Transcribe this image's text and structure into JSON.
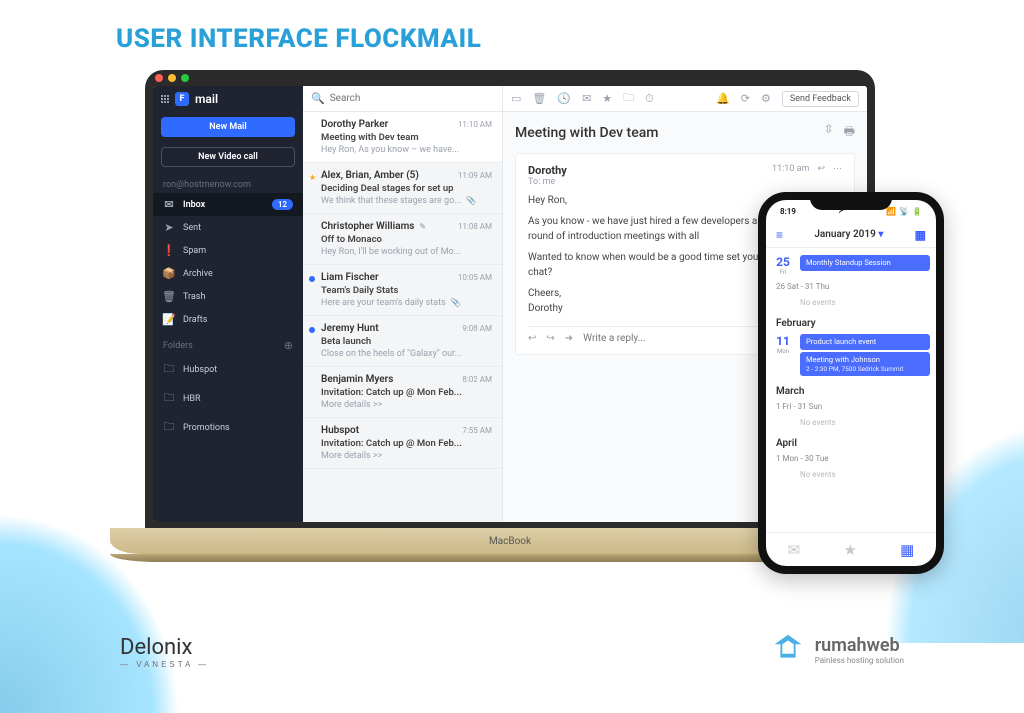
{
  "page_title": "USER INTERFACE FLOCKMAIL",
  "macbook_label": "MacBook",
  "app_brand": "mail",
  "sidebar": {
    "new_mail": "New Mail",
    "new_video": "New Video call",
    "account": "ron@hostmenow.com",
    "items": [
      {
        "icon": "✉",
        "label": "Inbox",
        "count": "12",
        "active": true
      },
      {
        "icon": "➤",
        "label": "Sent"
      },
      {
        "icon": "❗",
        "label": "Spam"
      },
      {
        "icon": "📦",
        "label": "Archive"
      },
      {
        "icon": "🗑",
        "label": "Trash"
      },
      {
        "icon": "📝",
        "label": "Drafts"
      }
    ],
    "folders_label": "Folders",
    "folders": [
      {
        "label": "Hubspot"
      },
      {
        "label": "HBR"
      },
      {
        "label": "Promotions"
      }
    ]
  },
  "search_placeholder": "Search",
  "toolbar": {
    "feedback": "Send Feedback"
  },
  "messages": [
    {
      "from": "Dorothy Parker",
      "time": "11:10 AM",
      "subj": "Meeting with Dev team",
      "prev": "Hey Ron, As you know – we have...",
      "sel": true
    },
    {
      "from": "Alex, Brian, Amber (5)",
      "time": "11:09 AM",
      "subj": "Deciding Deal stages for set up",
      "prev": "We think that these stages are go...",
      "star": true,
      "clip": true
    },
    {
      "from": "Christopher Williams",
      "time": "11:08 AM",
      "subj": "Off to Monaco",
      "prev": "Hey Ron, I'll be working out of Mo...",
      "pen": true
    },
    {
      "from": "Liam Fischer",
      "time": "10:05 AM",
      "subj": "Team's Daily Stats",
      "prev": "Here are your team's daily stats",
      "dot": true,
      "clip": true
    },
    {
      "from": "Jeremy Hunt",
      "time": "9:08 AM",
      "subj": "Beta launch",
      "prev": "Close on the heels of \"Galaxy\" our...",
      "dot": true
    },
    {
      "from": "Benjamin Myers",
      "time": "8:02 AM",
      "subj": "Invitation: Catch up @ Mon Feb...",
      "prev": "More details >>"
    },
    {
      "from": "Hubspot",
      "time": "7:55 AM",
      "subj": "Invitation: Catch up @ Mon Feb...",
      "prev": "More details >>"
    }
  ],
  "reader": {
    "subject": "Meeting with Dev team",
    "from": "Dorothy",
    "to": "To: me",
    "time": "11:10 am",
    "body": {
      "greeting": "Hey Ron,",
      "p1": "As you know - we have just hired a few developers and were doing a round of introduction meetings with all",
      "p2": "Wanted to know when would be a good time set you up for a quick chat?",
      "sign1": "Cheers,",
      "sign2": "Dorothy"
    },
    "reply_placeholder": "Write a reply..."
  },
  "phone": {
    "status_time": "8:19",
    "month": "January 2019",
    "sections": [
      {
        "day": "25",
        "wd": "Fri",
        "events": [
          {
            "title": "Monthly Standup Session"
          }
        ]
      },
      {
        "range": "26 Sat - 31 Thu",
        "noev": "No events"
      },
      {
        "header": "February"
      },
      {
        "day": "11",
        "wd": "Mon",
        "events": [
          {
            "title": "Product launch event"
          },
          {
            "title": "Meeting with Johnson",
            "sub": "2 - 2:30 PM, 7500 Sedrick Summit"
          }
        ]
      },
      {
        "header": "March"
      },
      {
        "range": "1 Fri - 31 Sun",
        "noev": "No events"
      },
      {
        "header": "April"
      },
      {
        "range": "1 Mon - 30 Tue",
        "noev": "No events"
      }
    ]
  },
  "footer": {
    "delonix": "Delonix",
    "delonix_sub": "— VANESTA —",
    "rumah_a": "rumah",
    "rumah_b": "web",
    "rumah_tag": "Painless hosting solution"
  }
}
